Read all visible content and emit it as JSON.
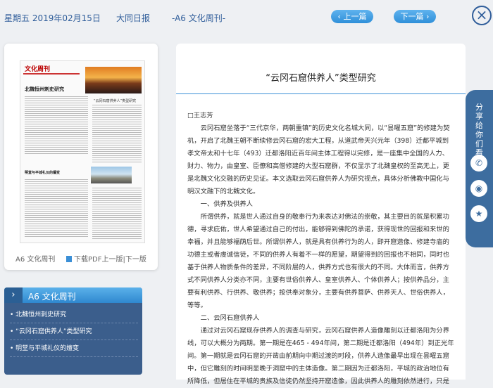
{
  "topbar": {
    "date": "星期五 2019年02月15日",
    "paper": "大同日报",
    "page": "-A6 文化周刊-",
    "prev_label": "上一篇",
    "next_label": "下一篇",
    "prev_icon": "chevron-left-icon",
    "next_icon": "chevron-right-icon",
    "close_icon": "close-icon"
  },
  "thumbnail": {
    "masthead": "文化周刊",
    "headline_main": "北魏恒州刺史研究",
    "headline_side": "“云冈石窟供养人”类型研究",
    "headline_lower": "明堂与平城礼仪的嬗变",
    "caption": "A6 文化周刊",
    "pdf_label": "下载PDF",
    "prev_page": "上一版",
    "separator": "|",
    "next_page": "下一版"
  },
  "section": {
    "title": "A6 文化周刊",
    "items": [
      "北魏恒州刺史研究",
      "“云冈石窟供养人”类型研究",
      "明堂与平城礼仪的嬗变"
    ]
  },
  "article": {
    "title": "“云冈石窟供养人”类型研究",
    "author": "□王志芳",
    "paragraphs": [
      "云冈石窟坐落于“三代京华，两朝重镇”的历史文化名城大同，以“昙曜五窟”的修建为契机，开启了北魏王朝不断续修云冈石窟的宏大工程，从道武帝天兴元年（398）迁都平城到孝文帝太和十七年（493）迁都洛阳近百年间主体工程得以完修，是一座集中全国的人力、财力、物力，由皇室、臣僚和高僧修建的大型石窟群，不仅显示了北魏皇权的至高无上，更是北魏文化交融的历史见证。本文选取云冈石窟供养人为研究视点，具体分析佛教中国化与明汉文融下的北魏文化。",
      "一、供养及供养人",
      "所谓供养，就是世人通过自身的敬奉行为来表达对佛法的崇敬，其主要目的就是积累功德，寻求庇佑，世人希望通过自己的付出，能够得到佛陀的承诺，获得现世的回报和来世的幸福，并且能够福荫后世。所谓供养人，就是具有供养行为的人，即开窟造像、修建寺庙的功德主或者虔诚信徒，不同的供养人有着不一样的愿望，期望得到的回报也不相同，同时也基于供养人物质条件的差异，不同阶层的人，供养方式也有很大的不同。大体而言，供养方式不同供养人分类亦不同，主要有世俗供养人、皇室供养人、个体供养人；按供养品分，主要有利供养、行供养、敬供养；按供奉对象分，主要有供养菩萨、供养天人、世俗供养人，等等。",
      "二、云冈石窟供养人",
      "通过对云冈石窟现存供养人的调查与研究，云冈石窟供养人造像雕刻以迁都洛阳为分界线，可以大概分为两期。第一期是在465 - 494年间，第二期是迁都洛阳（494年）到正光年间。第一期就是云冈石窟的开凿由前期向中期过渡的时段，供养人造像最早出现在昙曜五窟中，但它雕刻的时间明显晚于洞窟中的主体造像。第二期因为迁都洛阳，平城的政治地位有所降低，但居住在平城的贵族及信徒仍然坚持开窟造像，因此供养人的雕刻依然进行，只是"
    ]
  },
  "share": {
    "label": "分享给你们看看",
    "icons": [
      "wechat-icon",
      "weibo-icon",
      "favorite-star-icon"
    ]
  }
}
